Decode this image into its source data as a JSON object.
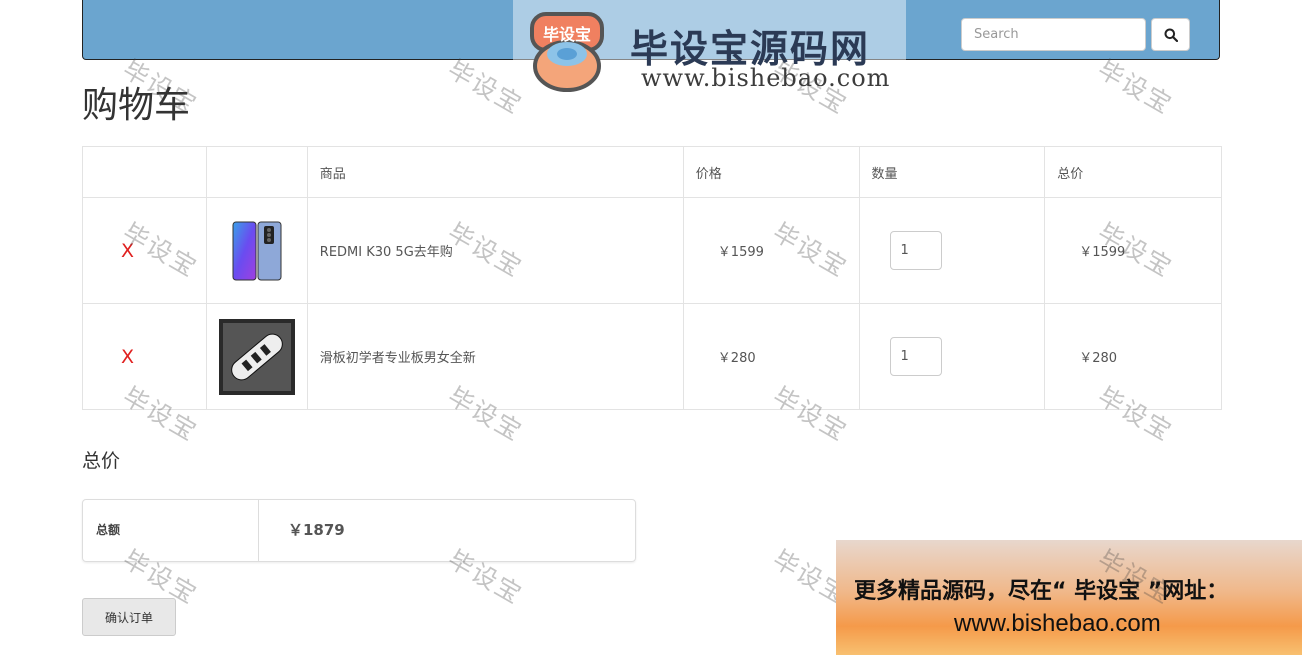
{
  "navbar": {
    "search_placeholder": "Search",
    "search_icon": "search-icon",
    "background": "#6ba5cf"
  },
  "logo": {
    "badge": "毕设宝",
    "name": "毕设宝源码网",
    "url": "www.bishebao.com"
  },
  "page_title": "购物车",
  "table": {
    "headers": [
      "",
      "",
      "商品",
      "价格",
      "数量",
      "总价"
    ],
    "rows": [
      {
        "delete": "X",
        "product_name": "REDMI K30 5G去年购",
        "price": "￥1599",
        "quantity": "1",
        "total": "￥1599",
        "image_icon": "phone-image"
      },
      {
        "delete": "X",
        "product_name": "滑板初学者专业板男女全新",
        "price": "￥280",
        "quantity": "1",
        "total": "￥280",
        "image_icon": "skateboard-image"
      }
    ]
  },
  "summary": {
    "title": "总价",
    "label": "总额",
    "value": "￥1879"
  },
  "confirm_label": "确认订单",
  "watermark": "毕设宝",
  "banner": {
    "line1": "更多精品源码，尽在“ 毕设宝 ”网址：",
    "line2": "www.bishebao.com"
  },
  "colors": {
    "delete": "#e0201f",
    "accent": "#6ba5cf"
  }
}
